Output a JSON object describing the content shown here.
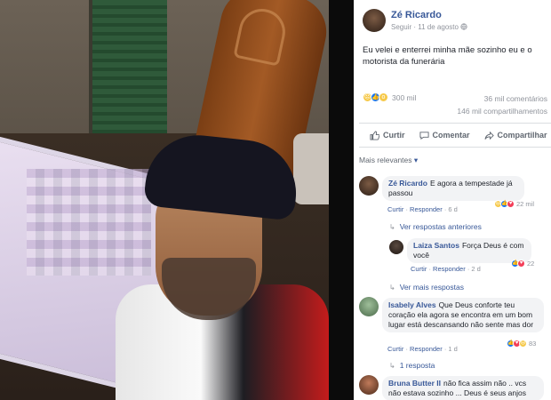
{
  "post": {
    "author": "Zé Ricardo",
    "follow": "Seguir",
    "separator": "·",
    "date": "11 de agosto",
    "privacy_icon": "globe-icon",
    "caption": "Eu velei e enterrei minha mãe sozinho eu e o motorista da funerária"
  },
  "reactions": {
    "count": "300 mil",
    "icons": [
      "sad-reaction-icon",
      "like-reaction-icon",
      "wow-reaction-icon"
    ],
    "comments": "36 mil comentários",
    "shares": "146 mil compartilhamentos"
  },
  "actions": {
    "like": "Curtir",
    "comment": "Comentar",
    "share": "Compartilhar"
  },
  "filter": {
    "label": "Mais relevantes",
    "caret": "▾"
  },
  "comments": [
    {
      "name": "Zé Ricardo",
      "text": "E agora a tempestade já passou",
      "like": "Curtir",
      "reply": "Responder",
      "time": "6 d",
      "dot": "·",
      "reaction_count": "22 mil"
    },
    {
      "name": "Laiza Santos",
      "text": "Força Deus é com você",
      "like": "Curtir",
      "reply": "Responder",
      "time": "2 d",
      "dot": "·",
      "reaction_count": "22"
    },
    {
      "name": "Isabely Alves",
      "text": "Que Deus conforte teu coração ela agora se encontra em um bom lugar está descansando não sente mas dor",
      "like": "Curtir",
      "reply": "Responder",
      "time": "1 d",
      "dot": "·",
      "reaction_count": "83"
    },
    {
      "name": "Bruna Butter II",
      "text": "não fica assim não .. vcs não estava sozinho ... Deus é seus anjos"
    }
  ],
  "links": {
    "previous_replies": "Ver respostas anteriores",
    "more_replies": "Ver mais respostas",
    "one_reply": "1 resposta"
  },
  "colors": {
    "link": "#385898",
    "muted": "#90949c",
    "bubble": "#f2f3f5",
    "like_blue": "#1877f2",
    "love_red": "#f33e58",
    "sad_yellow": "#f6c94a"
  }
}
